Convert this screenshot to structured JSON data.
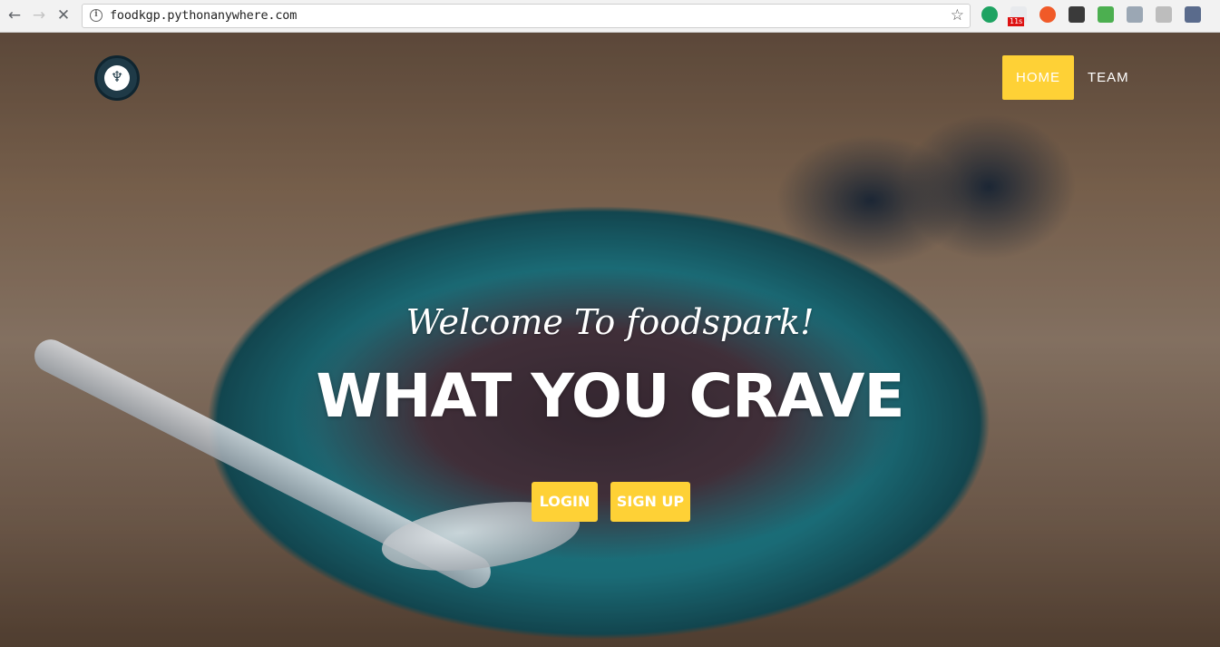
{
  "browser": {
    "url": "foodkgp.pythonanywhere.com",
    "back_icon": "arrow-left",
    "forward_icon": "arrow-right",
    "stop_icon": "close",
    "ext_badge": "11s"
  },
  "header": {
    "nav_home": "HOME",
    "nav_team": "TEAM"
  },
  "hero": {
    "subtitle": "Welcome To foodspark!",
    "headline": "WHAT YOU CRAVE",
    "login_label": "LOGIN",
    "signup_label": "SIGN UP"
  },
  "colors": {
    "accent": "#fed136"
  }
}
